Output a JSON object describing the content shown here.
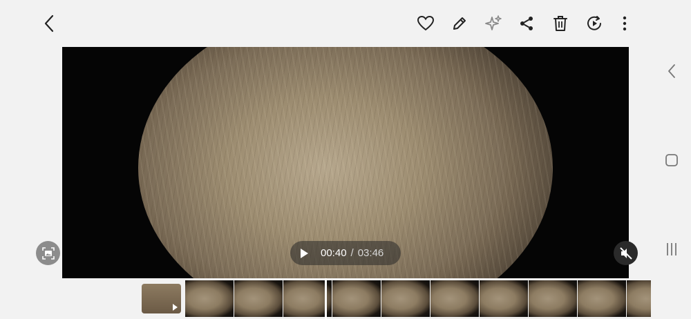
{
  "toolbar": {
    "icons": [
      "back-icon",
      "heart-icon",
      "edit-icon",
      "sparkle-icon",
      "share-icon",
      "delete-icon",
      "video-player-icon",
      "more-icon"
    ]
  },
  "player": {
    "current_time": "00:40",
    "separator": "/",
    "total_time": "03:46",
    "muted": true
  },
  "nav": {
    "icons": [
      "nav-back-icon",
      "nav-home-icon",
      "nav-recents-icon"
    ]
  },
  "filmstrip": {
    "frame_count": 10
  }
}
